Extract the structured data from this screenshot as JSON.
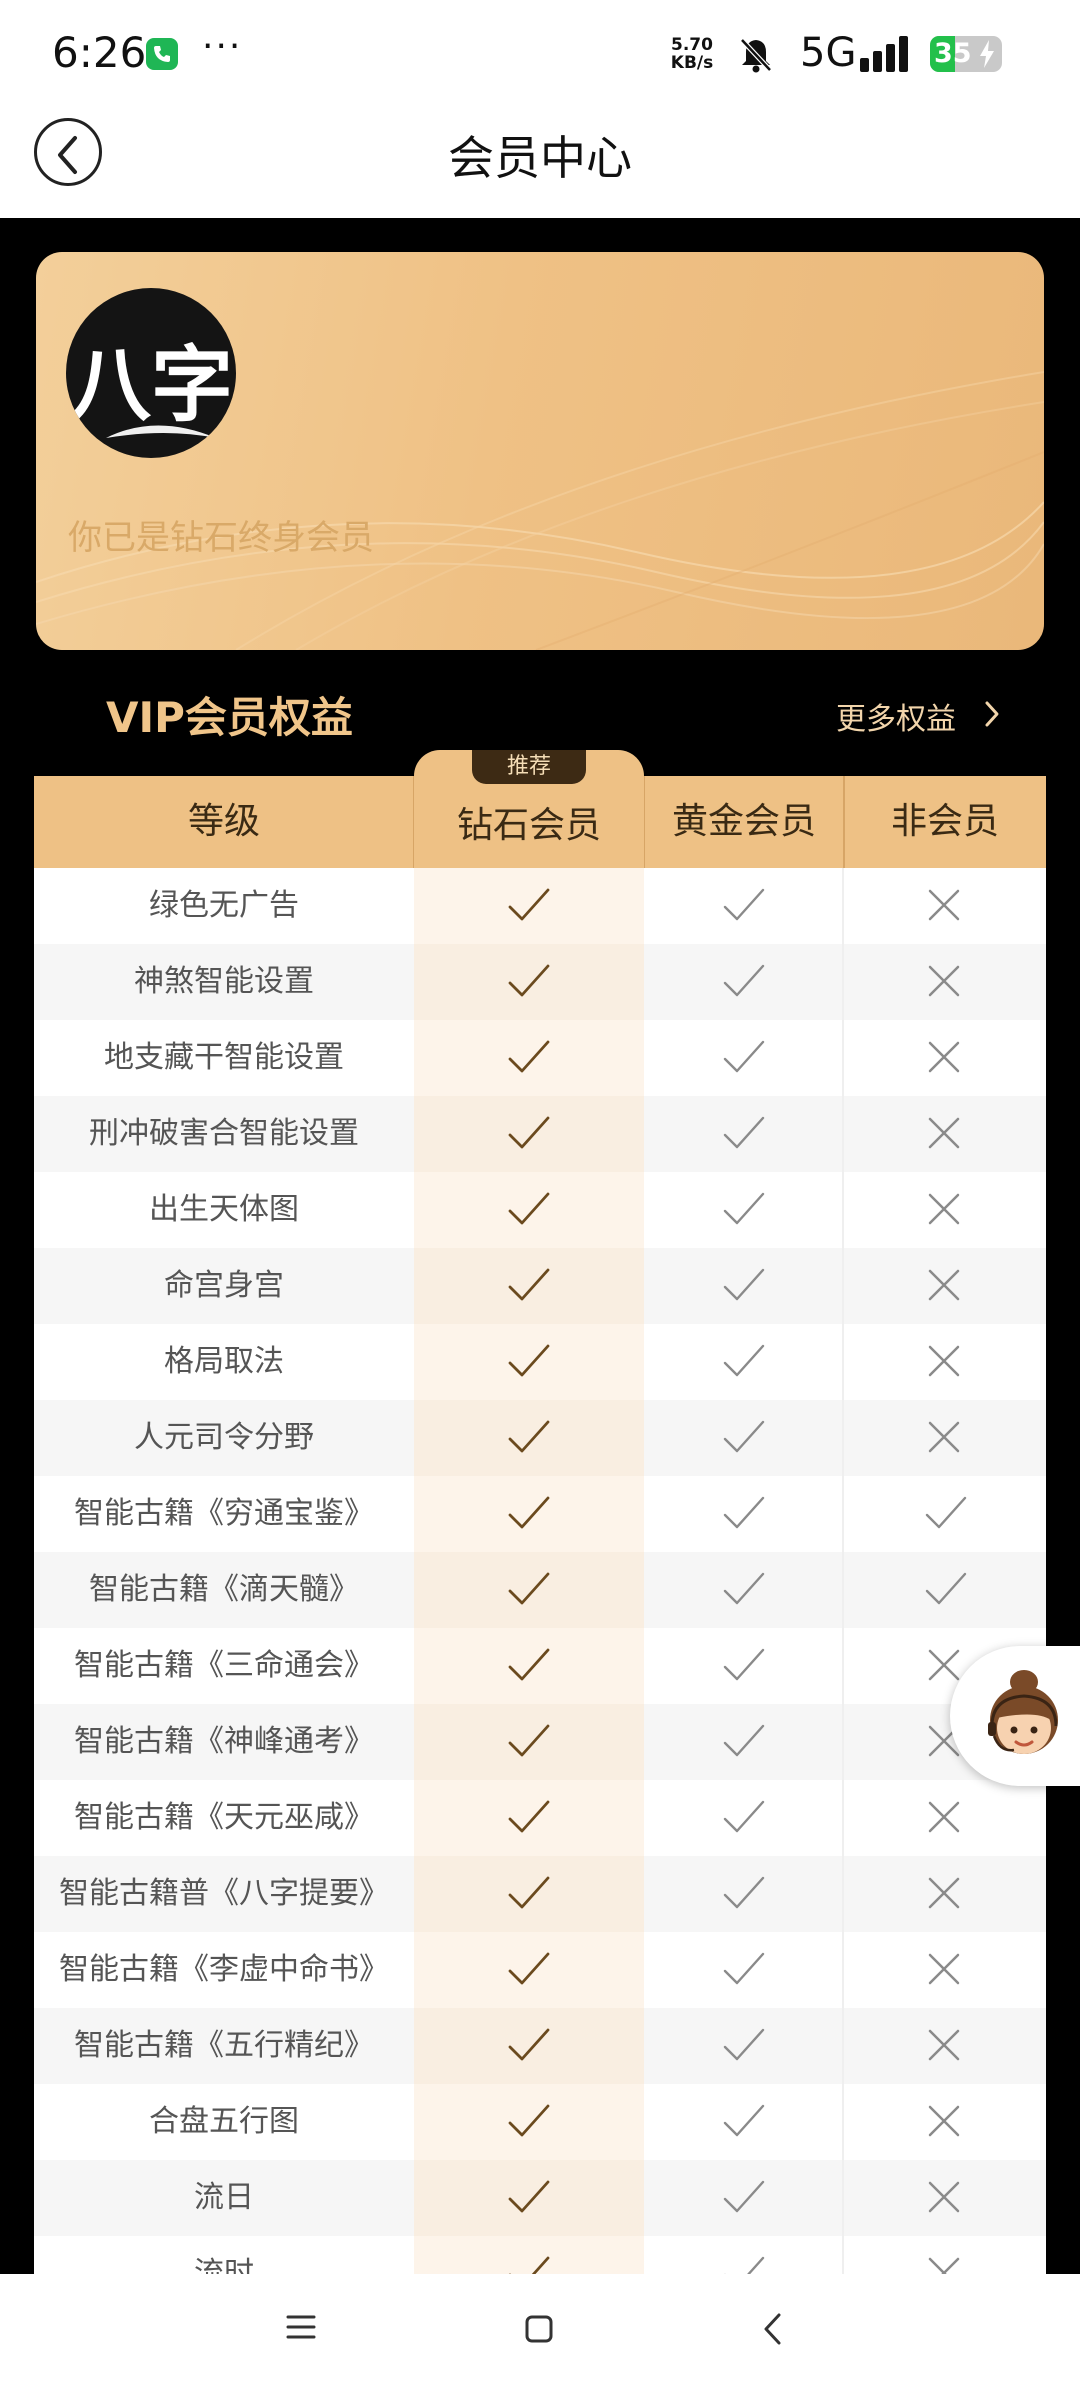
{
  "status_bar": {
    "time": "6:26",
    "more": "···",
    "net_speed_value": "5.70",
    "net_speed_unit": "KB/s",
    "network": "5G",
    "battery": "35",
    "battery_level": 0.35,
    "call_icon": "phone-icon",
    "bell_icon": "bell-muted-icon"
  },
  "header": {
    "title": "会员中心",
    "back_icon": "chevron-left-icon"
  },
  "member_card": {
    "avatar_text": "八字",
    "status_text": "你已是钻石终身会员"
  },
  "benefits": {
    "title": "VIP会员权益",
    "more_label": "更多权益",
    "recommend_badge": "推荐",
    "columns": [
      "等级",
      "钻石会员",
      "黄金会员",
      "非会员"
    ],
    "rows": [
      {
        "label": "绿色无广告",
        "diamond": true,
        "gold": true,
        "non": false
      },
      {
        "label": "神煞智能设置",
        "diamond": true,
        "gold": true,
        "non": false
      },
      {
        "label": "地支藏干智能设置",
        "diamond": true,
        "gold": true,
        "non": false
      },
      {
        "label": "刑冲破害合智能设置",
        "diamond": true,
        "gold": true,
        "non": false
      },
      {
        "label": "出生天体图",
        "diamond": true,
        "gold": true,
        "non": false
      },
      {
        "label": "命宫身宫",
        "diamond": true,
        "gold": true,
        "non": false
      },
      {
        "label": "格局取法",
        "diamond": true,
        "gold": true,
        "non": false
      },
      {
        "label": "人元司令分野",
        "diamond": true,
        "gold": true,
        "non": false
      },
      {
        "label": "智能古籍《穷通宝鉴》",
        "diamond": true,
        "gold": true,
        "non": true
      },
      {
        "label": "智能古籍《滴天髓》",
        "diamond": true,
        "gold": true,
        "non": true
      },
      {
        "label": "智能古籍《三命通会》",
        "diamond": true,
        "gold": true,
        "non": false
      },
      {
        "label": "智能古籍《神峰通考》",
        "diamond": true,
        "gold": true,
        "non": false
      },
      {
        "label": "智能古籍《天元巫咸》",
        "diamond": true,
        "gold": true,
        "non": false
      },
      {
        "label": "智能古籍普《八字提要》",
        "diamond": true,
        "gold": true,
        "non": false
      },
      {
        "label": "智能古籍《李虚中命书》",
        "diamond": true,
        "gold": true,
        "non": false
      },
      {
        "label": "智能古籍《五行精纪》",
        "diamond": true,
        "gold": true,
        "non": false
      },
      {
        "label": "合盘五行图",
        "diamond": true,
        "gold": true,
        "non": false
      },
      {
        "label": "流日",
        "diamond": true,
        "gold": true,
        "non": false
      },
      {
        "label": "流时",
        "diamond": true,
        "gold": true,
        "non": false
      }
    ]
  },
  "nav": {
    "menu_icon": "menu-icon",
    "home_icon": "home-icon",
    "back_icon": "back-icon"
  },
  "colors": {
    "accent_gold": "#eec185",
    "title_gold": "#f0c58a",
    "diamond_check": "#6b4a1e",
    "gray_mark": "#8a8a8a"
  }
}
